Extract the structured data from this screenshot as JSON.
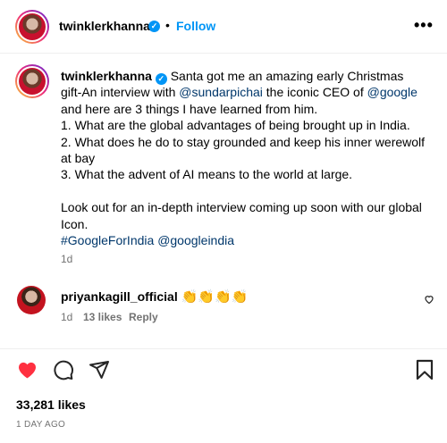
{
  "header": {
    "username": "twinklerkhanna",
    "separator": "•",
    "follow_label": "Follow",
    "more_label": "•••"
  },
  "caption": {
    "username": "twinklerkhanna",
    "text_1": " Santa got me an amazing early Christmas gift-An interview with ",
    "mention_1": "@sundarpichai",
    "text_2": " the iconic CEO of ",
    "mention_2": "@google",
    "text_3": " and here are 3 things I have learned from him.\n1. What are the global advantages of being brought up in India.\n2. What does he do to stay grounded and keep his inner werewolf at bay\n3. What the advent of AI means to the world at large.\n\nLook out for an in-depth interview coming up soon with our global Icon.\n",
    "hashtag": "#GoogleForIndia",
    "space": " ",
    "mention_3": "@googleindia",
    "time": "1d"
  },
  "comment": {
    "username": "priyankagill_official",
    "emojis": "👏👏👏👏",
    "time": "1d",
    "likes": "13 likes",
    "reply_label": "Reply"
  },
  "actions": {
    "like_color": "#ff3040"
  },
  "footer": {
    "likes": "33,281 likes",
    "date": "1 DAY AGO"
  }
}
